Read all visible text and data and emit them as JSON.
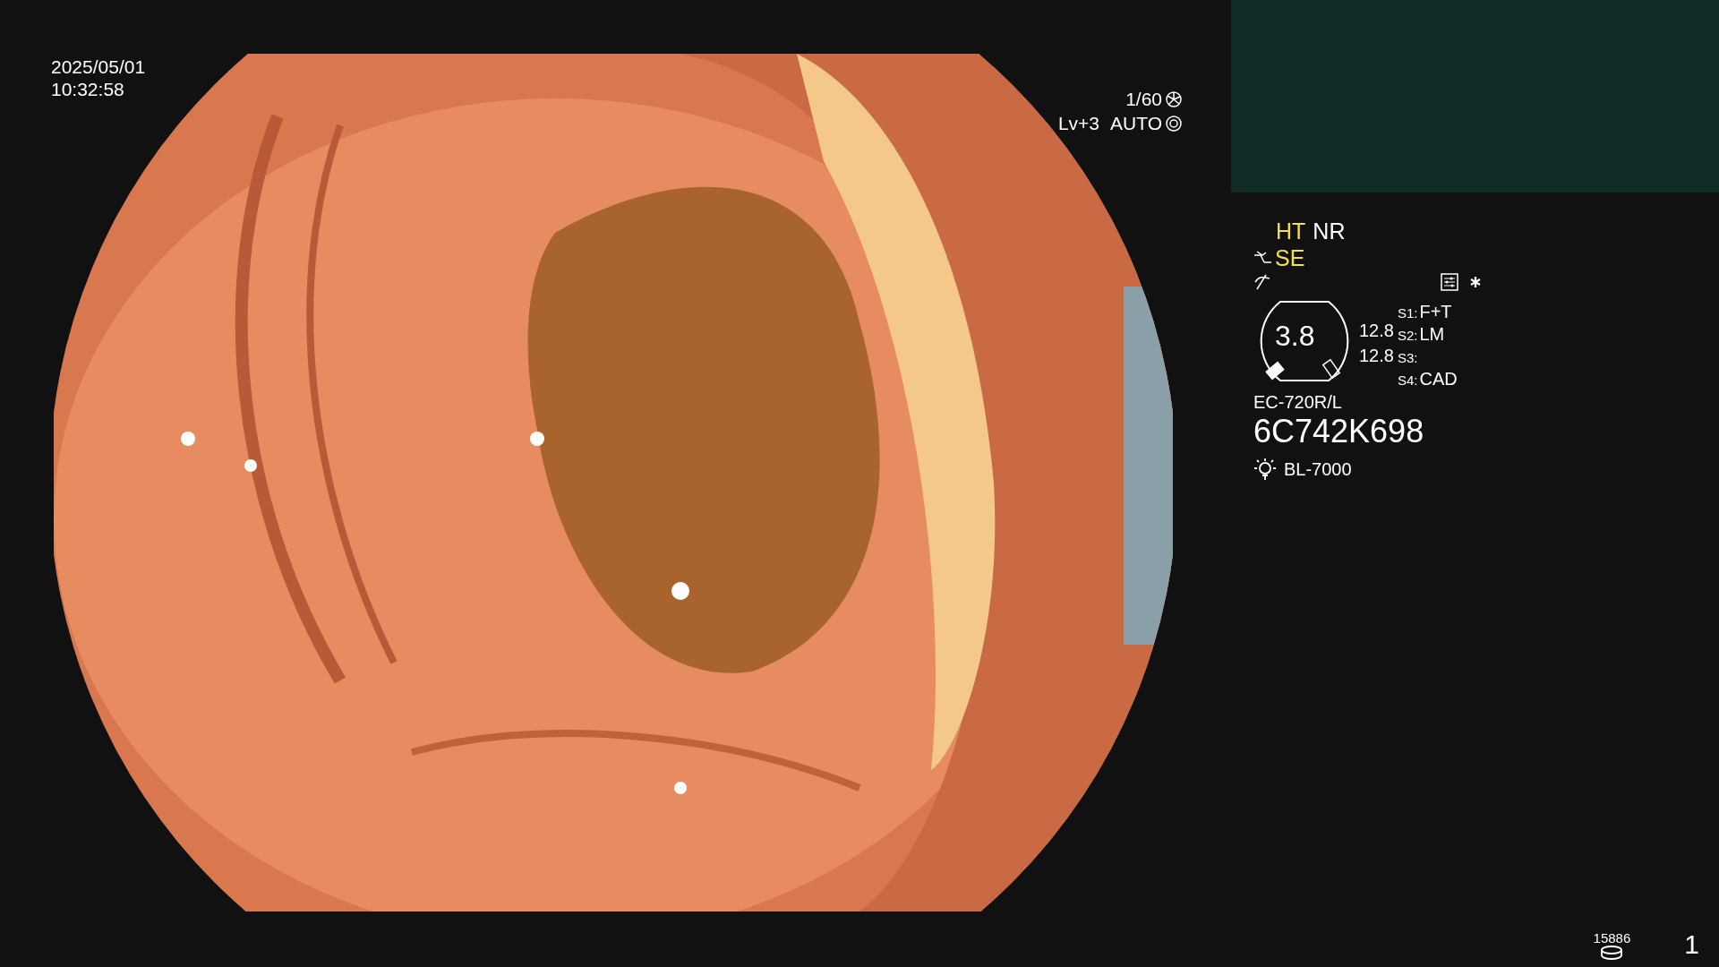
{
  "timestamp": {
    "date": "2025/05/01",
    "time": "10:32:58"
  },
  "exposure": {
    "shutter": "1/60",
    "level": "Lv+3",
    "iris": "AUTO"
  },
  "image_modes": [
    {
      "label": "HT",
      "highlighted": true
    },
    {
      "label": "NR",
      "highlighted": false
    }
  ],
  "enhancement": {
    "label": "SE",
    "highlighted": true
  },
  "zoom_gauge": {
    "value": "3.8",
    "readings": [
      "12.8",
      "12.8"
    ]
  },
  "switches": [
    {
      "label": "S1:",
      "value": "F+T"
    },
    {
      "label": "S2:",
      "value": "LM"
    },
    {
      "label": "S3:"
    },
    {
      "label": "S4:",
      "value": "CAD"
    }
  ],
  "scope": {
    "model": "EC-720R/L",
    "serial": "6C742K698"
  },
  "light_source": "BL-7000",
  "counter": "15886",
  "page": "1"
}
